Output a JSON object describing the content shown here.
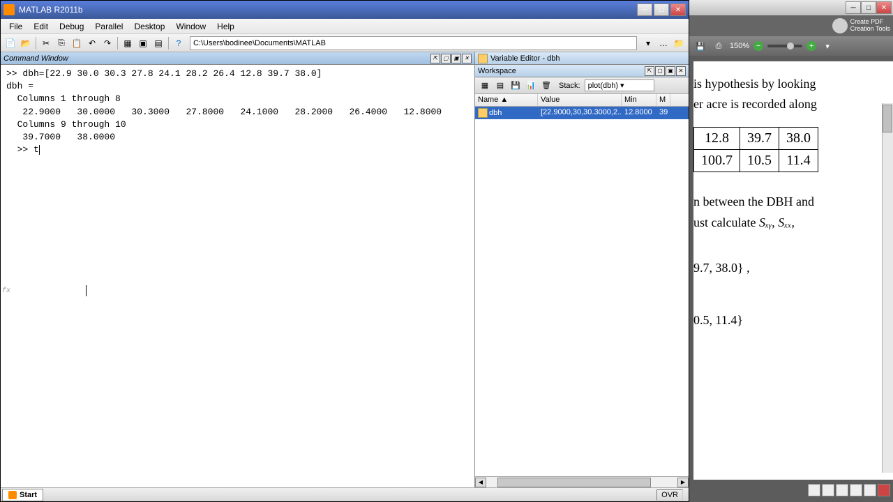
{
  "matlab": {
    "title": "MATLAB R2011b",
    "menus": [
      "File",
      "Edit",
      "Debug",
      "Parallel",
      "Desktop",
      "Window",
      "Help"
    ],
    "path": "C:\\Users\\bodinee\\Documents\\MATLAB",
    "cmd_window_title": "Command Window",
    "var_editor_title": "Variable Editor - dbh",
    "workspace_title": "Workspace",
    "stack_label": "Stack:",
    "stack_value": "plot(dbh)",
    "ws_headers": {
      "name": "Name",
      "value": "Value",
      "min": "Min",
      "max": "M"
    },
    "ws_sort_arrow": "▲",
    "ws_row": {
      "name": "dbh",
      "value": "[22.9000,30,30.3000,2...",
      "min": "12.8000",
      "max": "39"
    },
    "cmd_lines": [
      ">> dbh=[22.9 30.0 30.3 27.8 24.1 28.2 26.4 12.8 39.7 38.0]",
      "",
      "dbh =",
      "",
      "  Columns 1 through 8",
      "",
      "   22.9000   30.0000   30.3000   27.8000   24.1000   28.2000   26.4000   12.8000",
      "",
      "  Columns 9 through 10",
      "",
      "   39.7000   38.0000",
      ""
    ],
    "prompt": "  >> t",
    "fx": "fx",
    "start": "Start",
    "ovr": "OVR"
  },
  "pdf": {
    "create_tools": "Create PDF\nCreation Tools",
    "zoom": "150%",
    "text1": "is hypothesis by looking",
    "text2": "er acre is recorded along",
    "table_row1": [
      "12.8",
      "39.7",
      "38.0"
    ],
    "table_row2": [
      "100.7",
      "10.5",
      "11.4"
    ],
    "text3": "n between the DBH and",
    "text4_a": "ust calculate ",
    "text4_sxy": "Sₓᵧ",
    "text4_sxx": "Sₓₓ",
    "text5": "9.7, 38.0} ,",
    "text6": "0.5, 11.4}"
  }
}
